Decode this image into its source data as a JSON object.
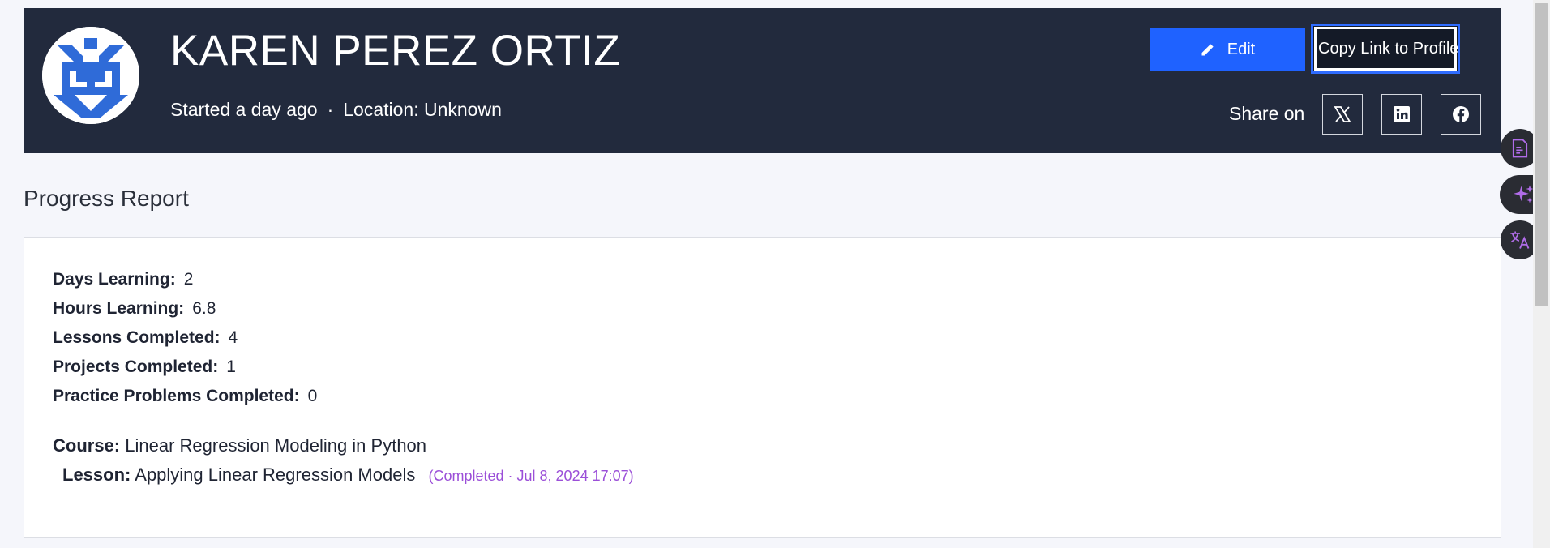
{
  "profile": {
    "name": "KAREN PEREZ ORTIZ",
    "started": "Started a day ago",
    "separator": "·",
    "location": "Location: Unknown",
    "avatar_icon": "identicon-avatar"
  },
  "actions": {
    "edit_label": "Edit",
    "edit_icon": "pencil-icon",
    "copy_label": "Copy Link to Profile"
  },
  "share": {
    "label": "Share on",
    "platforms": [
      "x-icon",
      "linkedin-icon",
      "facebook-icon"
    ]
  },
  "side_tools": [
    "document-icon",
    "sparkle-icon",
    "translate-icon"
  ],
  "progress": {
    "title": "Progress Report",
    "stats": [
      {
        "label": "Days Learning:",
        "value": "2"
      },
      {
        "label": "Hours Learning:",
        "value": "6.8"
      },
      {
        "label": "Lessons Completed:",
        "value": "4"
      },
      {
        "label": "Projects Completed:",
        "value": "1"
      },
      {
        "label": "Practice Problems Completed:",
        "value": "0"
      }
    ],
    "course_label": "Course:",
    "course_value": "Linear Regression Modeling in Python",
    "lesson_label": "Lesson:",
    "lesson_value": "Applying Linear Regression Models",
    "lesson_status": "(Completed · Jul 8, 2024 17:07)"
  },
  "colors": {
    "header_bg": "#222a3d",
    "accent": "#1f62ff",
    "status": "#9b4fd8",
    "page_bg": "#f5f6fb"
  }
}
